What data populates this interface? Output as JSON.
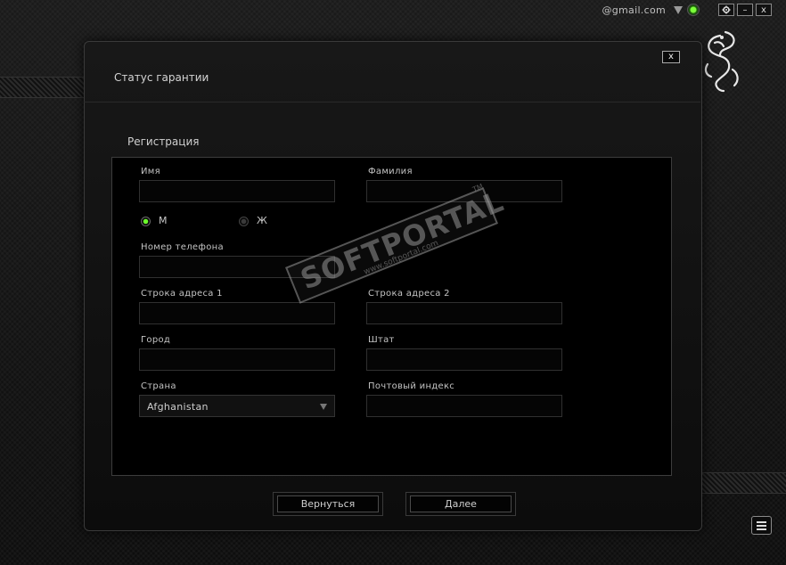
{
  "topbar": {
    "email": "@gmail.com",
    "window_buttons": {
      "settings_icon": "gear-icon",
      "minimize_label": "–",
      "close_label": "x"
    }
  },
  "dialog": {
    "title": "Статус гарантии",
    "close_label": "x"
  },
  "form": {
    "section_title": "Регистрация",
    "first_name_label": "Имя",
    "last_name_label": "Фамилия",
    "gender_male_label": "М",
    "gender_female_label": "Ж",
    "gender_selected": "М",
    "phone_label": "Номер телефона",
    "address1_label": "Строка адреса 1",
    "address2_label": "Строка адреса 2",
    "city_label": "Город",
    "state_label": "Штат",
    "country_label": "Страна",
    "country_value": "Afghanistan",
    "zip_label": "Почтовый индекс",
    "first_name_value": "",
    "last_name_value": "",
    "phone_value": "",
    "address1_value": "",
    "address2_value": "",
    "city_value": "",
    "state_value": "",
    "zip_value": ""
  },
  "buttons": {
    "back_label": "Вернуться",
    "next_label": "Далее"
  },
  "watermark": {
    "text": "SOFTPORTAL",
    "url": "www.softportal.com",
    "tm": "TM"
  },
  "colors": {
    "accent": "#6cff2a",
    "background": "#101010"
  }
}
